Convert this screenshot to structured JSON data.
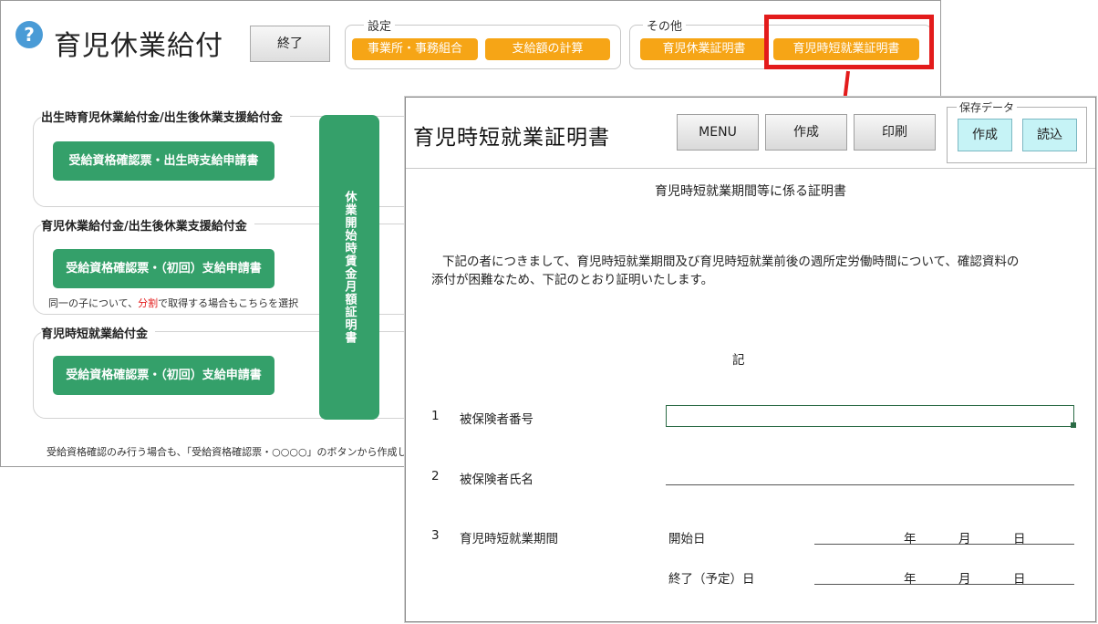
{
  "back_window": {
    "title": "育児休業給付",
    "help_icon": "?",
    "exit_button": "終了",
    "settings_group": {
      "label": "設定",
      "buttons": [
        "事業所・事務組合",
        "支給額の計算"
      ]
    },
    "other_group": {
      "label": "その他",
      "buttons": [
        "育児休業証明書",
        "育児時短就業証明書"
      ]
    },
    "sections": [
      {
        "heading": "出生時育児休業給付金/出生後休業支援給付金",
        "button": "受給資格確認票・出生時支給申請書",
        "note": ""
      },
      {
        "heading": "育児休業給付金/出生後休業支援給付金",
        "button": "受給資格確認票・（初回）支給申請書",
        "note_prefix": "同一の子について、",
        "note_highlight": "分割",
        "note_suffix": "で取得する場合もこちらを選択"
      },
      {
        "heading": "育児時短就業給付金",
        "button": "受給資格確認票・（初回）支給申請書"
      }
    ],
    "vertical_button": "休業開始時賃金月額証明書",
    "footer_note": "受給資格確認のみ行う場合も、「受給資格確認票・○○○○」のボタンから作成してくだ"
  },
  "front_window": {
    "title": "育児時短就業証明書",
    "buttons": {
      "menu": "MENU",
      "create": "作成",
      "print": "印刷"
    },
    "save_data": {
      "label": "保存データ",
      "create": "作成",
      "load": "読込"
    },
    "doc_title": "育児時短就業期間等に係る証明書",
    "intro_line1": "下記の者につきまして、育児時短就業期間及び育児時短就業前後の週所定労働時間について、確認資料の",
    "intro_line2": "添付が困難なため、下記のとおり証明いたします。",
    "ki": "記",
    "items": [
      {
        "num": "1",
        "label": "被保険者番号",
        "value": ""
      },
      {
        "num": "2",
        "label": "被保険者氏名",
        "value": ""
      },
      {
        "num": "3",
        "label": "育児時短就業期間"
      }
    ],
    "period": {
      "start_label": "開始日",
      "end_label": "終了（予定）日",
      "year": "年",
      "month": "月",
      "day": "日"
    }
  },
  "colors": {
    "orange": "#f6a516",
    "green": "#34a06a",
    "red": "#e31b1b",
    "cyan": "#c6f3f6"
  }
}
